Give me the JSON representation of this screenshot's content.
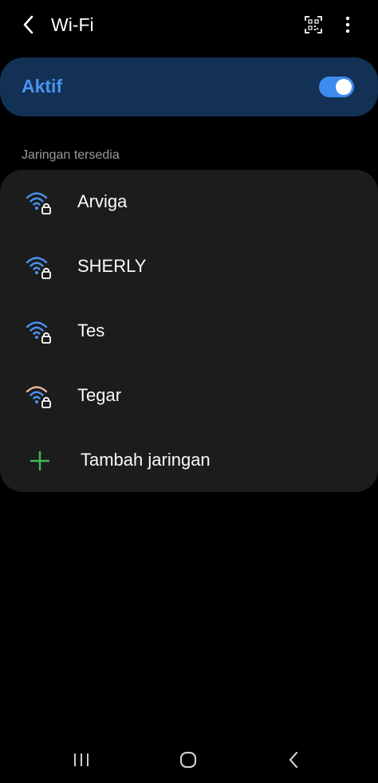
{
  "header": {
    "title": "Wi-Fi",
    "back_icon": "chevron-left-icon",
    "qr_icon": "qr-scan-icon",
    "more_icon": "more-vertical-icon"
  },
  "master_switch": {
    "label": "Aktif",
    "state": "on",
    "accent_color": "#4a93f2"
  },
  "available": {
    "header": "Jaringan tersedia",
    "networks": [
      {
        "name": "Arviga",
        "icon": "wifi-lock-icon",
        "secured": true,
        "signal_color": "#4a93f2"
      },
      {
        "name": "SHERLY",
        "icon": "wifi-lock-icon",
        "secured": true,
        "signal_color": "#4a93f2"
      },
      {
        "name": "Tes",
        "icon": "wifi-lock-icon",
        "secured": true,
        "signal_color": "#4a93f2"
      },
      {
        "name": "Tegar",
        "icon": "wifi-lock-icon",
        "secured": true,
        "signal_color": "#e9b49a"
      }
    ],
    "add_network": {
      "label": "Tambah jaringan",
      "icon": "plus-icon",
      "color": "#3dbb5a"
    }
  },
  "navbar": {
    "recents_icon": "recents-icon",
    "home_icon": "home-icon",
    "back_icon": "back-icon"
  }
}
